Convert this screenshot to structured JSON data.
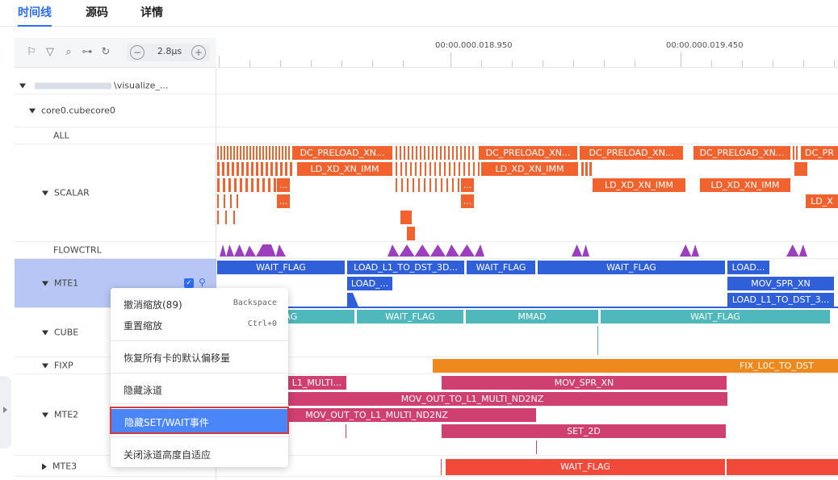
{
  "tabs": [
    {
      "label": "时间线",
      "active": true
    },
    {
      "label": "源码",
      "active": false
    },
    {
      "label": "详情",
      "active": false
    }
  ],
  "toolbar": {
    "icons": [
      "flag-icon",
      "filter-icon",
      "search-icon",
      "link-icon",
      "reset-icon"
    ],
    "zoom_out": "−",
    "zoom_value": "2.8μs",
    "zoom_in": "+"
  },
  "ruler": {
    "labels": [
      "00:00.000.018.950",
      "00:00.000.019.450"
    ]
  },
  "tree": {
    "root_path_suffix": "\\visualize_...",
    "core": "core0.cubecore0"
  },
  "lanes": {
    "all": "ALL",
    "scalar": "SCALAR",
    "flowctrl": "FLOWCTRL",
    "mte1": "MTE1",
    "cube": "CUBE",
    "fixp": "FIXP",
    "mte2": "MTE2",
    "mte3": "MTE3"
  },
  "blocks": {
    "dc_preload": "DC_PRELOAD_XN...",
    "dc_pre_short": "DC_PR",
    "ld_xd": "LD_XD_XN_IMM",
    "ld_x_short": "LD_X",
    "ellipsis": "...",
    "wait_flag": "WAIT_FLAG",
    "load_l1_3d": "LOAD_L1_TO_DST_3D...",
    "load_short": "LOAD...",
    "load_short2": "LOAD_...",
    "mov_spr": "MOV_SPR_XN",
    "load_l1_3": "LOAD_L1_TO_DST_3...",
    "flag": "FLAG",
    "mmad": "MMAD",
    "fix_l0c": "FIX_L0C_TO_DST",
    "l1_multi": "L1_MULTI...",
    "mov_out_nd2nz": "MOV_OUT_TO_L1_MULTI_ND2NZ",
    "set_2d": "SET_2D"
  },
  "context_menu": {
    "items": [
      {
        "label": "撤消缩放(89)",
        "shortcut": "Backspace"
      },
      {
        "label": "重置缩放",
        "shortcut": "Ctrl+0"
      },
      {
        "label": "恢复所有卡的默认偏移量",
        "shortcut": ""
      },
      {
        "label": "隐藏泳道",
        "shortcut": ""
      },
      {
        "label": "隐藏SET/WAIT事件",
        "shortcut": "",
        "highlighted": true
      },
      {
        "label": "关闭泳道高度自适应",
        "shortcut": ""
      }
    ]
  },
  "colors": {
    "accent": "#2c6ef2",
    "scalar": "#f2622e",
    "mte1": "#2f5fd9",
    "cube": "#4fb8bd",
    "fixp": "#ee8a1d",
    "mte2": "#cf3f70",
    "mte3": "#f24a3a",
    "flowctrl": "#9b3fbf"
  }
}
